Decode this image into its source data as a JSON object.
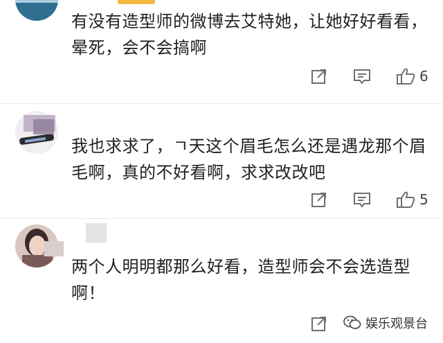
{
  "comments": [
    {
      "text": "有没有造型师的微博去艾特她，让她好好看看，晕死，会不会搞啊",
      "likes": "6",
      "avatar_color": "#9fc3d8"
    },
    {
      "text": "我也求求了，ㄱ天这个眉毛怎么还是遇龙那个眉毛啊，真的不好看啊，求求改改吧",
      "likes": "5",
      "avatar_color": "#e9e4ea"
    },
    {
      "text": "两个人明明都那么好看，造型师会不会选造型啊！",
      "likes": "",
      "avatar_color": "#c9a59a"
    }
  ],
  "watermark": {
    "text": "娱乐观景台",
    "icon": "wechat-official-account-icon"
  },
  "colors": {
    "icon_gray": "#6e6e6e",
    "divider": "#eaeaea",
    "accent": "#f5b942"
  }
}
